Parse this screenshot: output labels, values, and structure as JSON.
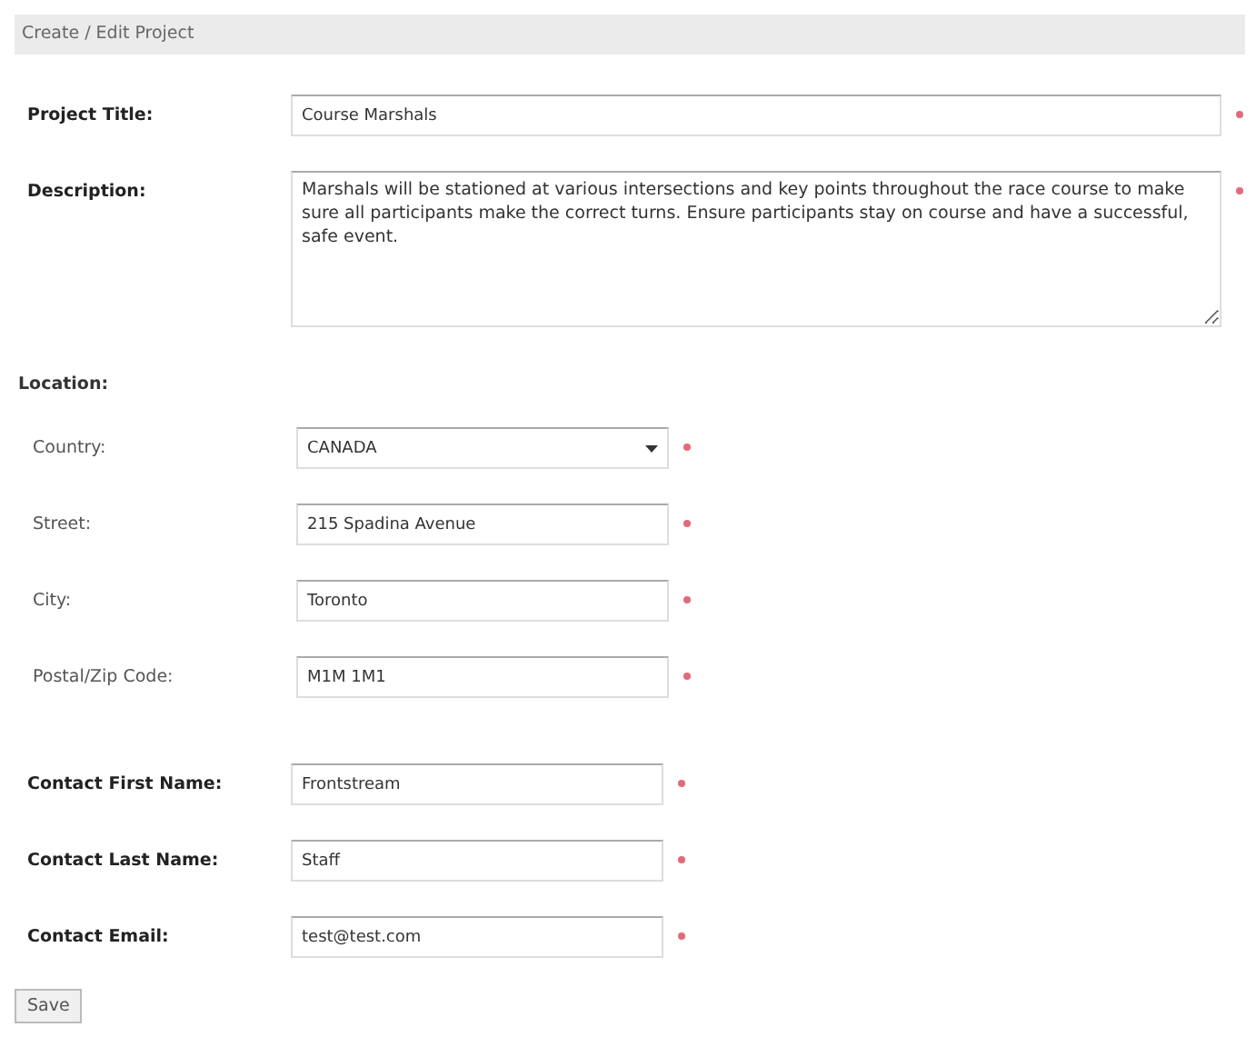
{
  "header": {
    "title": "Create / Edit Project"
  },
  "groups": [
    {
      "bold": true,
      "fields": [
        {
          "label": "Project Title:",
          "kind": "text",
          "value": "Course Marshals",
          "required": true
        },
        {
          "label": "Description:",
          "kind": "textarea",
          "value": "Marshals will be stationed at various intersections and key points throughout the race course to make sure all participants make the correct turns. Ensure participants stay on course and have a successful, safe event.",
          "required": true
        }
      ]
    },
    {
      "heading": "Location:",
      "bold": false,
      "fields": [
        {
          "label": "Country:",
          "kind": "select",
          "value": "CANADA",
          "required": true
        },
        {
          "label": "Street:",
          "kind": "text",
          "value": "215 Spadina Avenue",
          "required": true
        },
        {
          "label": "City:",
          "kind": "text",
          "value": "Toronto",
          "required": true
        },
        {
          "label": "Postal/Zip Code:",
          "kind": "text",
          "value": "M1M 1M1",
          "required": true
        }
      ]
    },
    {
      "bold": true,
      "fields": [
        {
          "label": "Contact First Name:",
          "kind": "text",
          "value": "Frontstream",
          "required": true
        },
        {
          "label": "Contact Last Name:",
          "kind": "text",
          "value": "Staff",
          "required": true
        },
        {
          "label": "Contact Email:",
          "kind": "text",
          "value": "test@test.com",
          "required": true
        }
      ]
    }
  ],
  "buttons": [
    {
      "label": "Save"
    }
  ]
}
